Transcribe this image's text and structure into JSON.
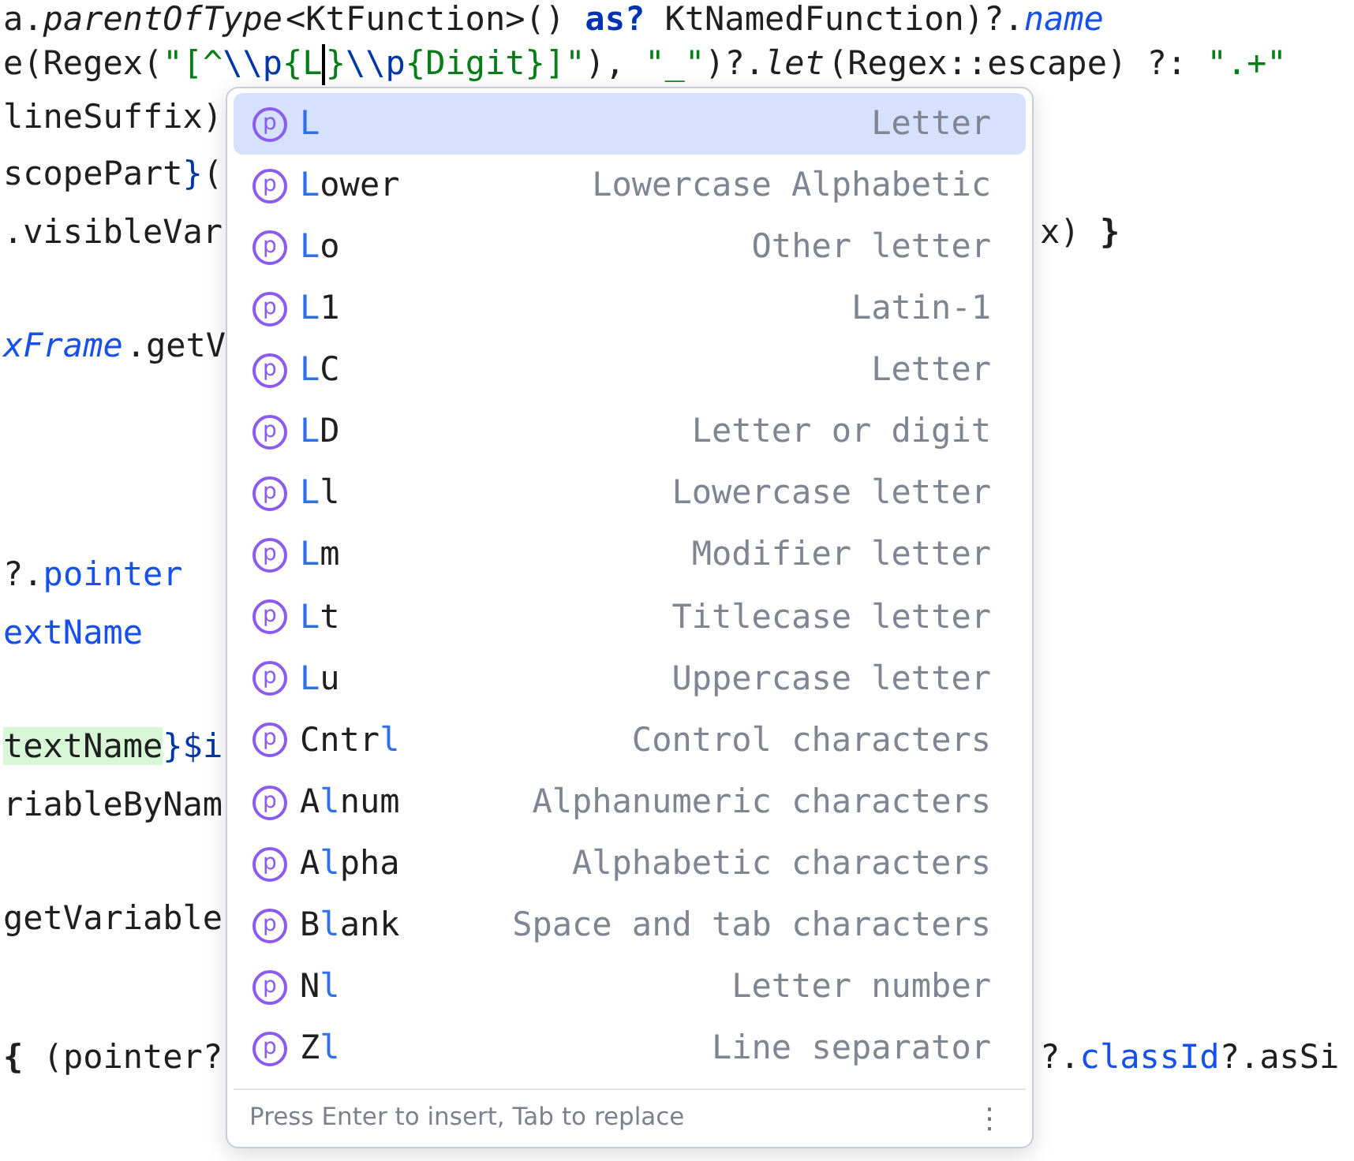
{
  "editor": {
    "lines": [
      {
        "kind": "code",
        "left": [
          {
            "text": "a.",
            "kind": "plain"
          },
          {
            "text": "parentOfType",
            "kind": "italic"
          },
          {
            "text": "<KtFunction>() ",
            "kind": "plain"
          },
          {
            "text": "as?",
            "kind": "keyword"
          },
          {
            "text": " KtNamedFunction)?.",
            "kind": "plain"
          },
          {
            "text": "name",
            "kind": "field-italic"
          }
        ]
      },
      {
        "kind": "code",
        "left": [
          {
            "text": "e(Regex(",
            "kind": "plain"
          },
          {
            "text": "\"[^",
            "kind": "string"
          },
          {
            "text": "\\\\p",
            "kind": "escape"
          },
          {
            "text": "{L",
            "kind": "string"
          },
          {
            "kind": "caret"
          },
          {
            "text": "}",
            "kind": "string"
          },
          {
            "text": "\\\\p",
            "kind": "escape"
          },
          {
            "text": "{Digit}]\"",
            "kind": "string"
          },
          {
            "text": "), ",
            "kind": "plain"
          },
          {
            "text": "\"_\"",
            "kind": "string"
          },
          {
            "text": ")?.",
            "kind": "plain"
          },
          {
            "text": "let",
            "kind": "italic"
          },
          {
            "text": "(Regex::escape) ?: ",
            "kind": "plain"
          },
          {
            "text": "\".+\"",
            "kind": "string"
          }
        ]
      },
      {
        "kind": "code",
        "left": [
          {
            "text": "lineSuffix)",
            "kind": "plain"
          }
        ]
      },
      {
        "kind": "code",
        "left": [
          {
            "text": "scopePart",
            "kind": "plain"
          },
          {
            "text": "}",
            "kind": "template"
          },
          {
            "text": "(",
            "kind": "plain"
          }
        ]
      },
      {
        "kind": "code",
        "left": [
          {
            "text": ".visibleVar",
            "kind": "plain"
          }
        ],
        "right": [
          {
            "text": "x) ",
            "kind": "plain"
          },
          {
            "text": "}",
            "kind": "bold"
          }
        ]
      },
      {
        "kind": "blank"
      },
      {
        "kind": "code",
        "left": [
          {
            "text": "xFrame",
            "kind": "field-italic"
          },
          {
            "text": ".getV",
            "kind": "plain"
          }
        ]
      },
      {
        "kind": "blank"
      },
      {
        "kind": "blank"
      },
      {
        "kind": "blank"
      },
      {
        "kind": "code",
        "left": [
          {
            "text": "?.",
            "kind": "plain"
          },
          {
            "text": "pointer",
            "kind": "field"
          }
        ]
      },
      {
        "kind": "code",
        "left": [
          {
            "text": "extName",
            "kind": "field"
          }
        ]
      },
      {
        "kind": "blank"
      },
      {
        "kind": "code",
        "left": [
          {
            "text": "textName",
            "kind": "highlight"
          },
          {
            "text": "}$i",
            "kind": "template"
          }
        ]
      },
      {
        "kind": "code",
        "left": [
          {
            "text": "riableByNam",
            "kind": "plain"
          }
        ]
      },
      {
        "kind": "blank"
      },
      {
        "kind": "code",
        "left": [
          {
            "text": "getVariable",
            "kind": "plain"
          }
        ]
      },
      {
        "kind": "blank"
      },
      {
        "kind": "code",
        "left": [
          {
            "text": "{",
            "kind": "bold"
          },
          {
            "text": " (pointer?",
            "kind": "plain"
          }
        ],
        "right": [
          {
            "text": "?.",
            "kind": "plain"
          },
          {
            "text": "classId",
            "kind": "field"
          },
          {
            "text": "?.asSi",
            "kind": "plain"
          }
        ]
      }
    ]
  },
  "completion": {
    "items": [
      {
        "icon": "p",
        "name": [
          {
            "text": "L",
            "match": true
          }
        ],
        "description": "Letter",
        "selected": true
      },
      {
        "icon": "p",
        "name": [
          {
            "text": "L",
            "match": true
          },
          {
            "text": "ower",
            "match": false
          }
        ],
        "description": "Lowercase Alphabetic",
        "selected": false
      },
      {
        "icon": "p",
        "name": [
          {
            "text": "L",
            "match": true
          },
          {
            "text": "o",
            "match": false
          }
        ],
        "description": "Other letter",
        "selected": false
      },
      {
        "icon": "p",
        "name": [
          {
            "text": "L",
            "match": true
          },
          {
            "text": "1",
            "match": false
          }
        ],
        "description": "Latin-1",
        "selected": false
      },
      {
        "icon": "p",
        "name": [
          {
            "text": "L",
            "match": true
          },
          {
            "text": "C",
            "match": false
          }
        ],
        "description": "Letter",
        "selected": false
      },
      {
        "icon": "p",
        "name": [
          {
            "text": "L",
            "match": true
          },
          {
            "text": "D",
            "match": false
          }
        ],
        "description": "Letter or digit",
        "selected": false
      },
      {
        "icon": "p",
        "name": [
          {
            "text": "L",
            "match": true
          },
          {
            "text": "l",
            "match": false
          }
        ],
        "description": "Lowercase letter",
        "selected": false
      },
      {
        "icon": "p",
        "name": [
          {
            "text": "L",
            "match": true
          },
          {
            "text": "m",
            "match": false
          }
        ],
        "description": "Modifier letter",
        "selected": false
      },
      {
        "icon": "p",
        "name": [
          {
            "text": "L",
            "match": true
          },
          {
            "text": "t",
            "match": false
          }
        ],
        "description": "Titlecase letter",
        "selected": false
      },
      {
        "icon": "p",
        "name": [
          {
            "text": "L",
            "match": true
          },
          {
            "text": "u",
            "match": false
          }
        ],
        "description": "Uppercase letter",
        "selected": false
      },
      {
        "icon": "p",
        "name": [
          {
            "text": "Cntr",
            "match": false
          },
          {
            "text": "l",
            "match": true
          }
        ],
        "description": "Control characters",
        "selected": false
      },
      {
        "icon": "p",
        "name": [
          {
            "text": "A",
            "match": false
          },
          {
            "text": "l",
            "match": true
          },
          {
            "text": "num",
            "match": false
          }
        ],
        "description": "Alphanumeric characters",
        "selected": false
      },
      {
        "icon": "p",
        "name": [
          {
            "text": "A",
            "match": false
          },
          {
            "text": "l",
            "match": true
          },
          {
            "text": "pha",
            "match": false
          }
        ],
        "description": "Alphabetic characters",
        "selected": false
      },
      {
        "icon": "p",
        "name": [
          {
            "text": "B",
            "match": false
          },
          {
            "text": "l",
            "match": true
          },
          {
            "text": "ank",
            "match": false
          }
        ],
        "description": "Space and tab characters",
        "selected": false
      },
      {
        "icon": "p",
        "name": [
          {
            "text": "N",
            "match": false
          },
          {
            "text": "l",
            "match": true
          }
        ],
        "description": "Letter number",
        "selected": false
      },
      {
        "icon": "p",
        "name": [
          {
            "text": "Z",
            "match": false
          },
          {
            "text": "l",
            "match": true
          }
        ],
        "description": "Line separator",
        "selected": false
      }
    ],
    "hint": "Press Enter to insert, Tab to replace",
    "menu": "⋮"
  }
}
